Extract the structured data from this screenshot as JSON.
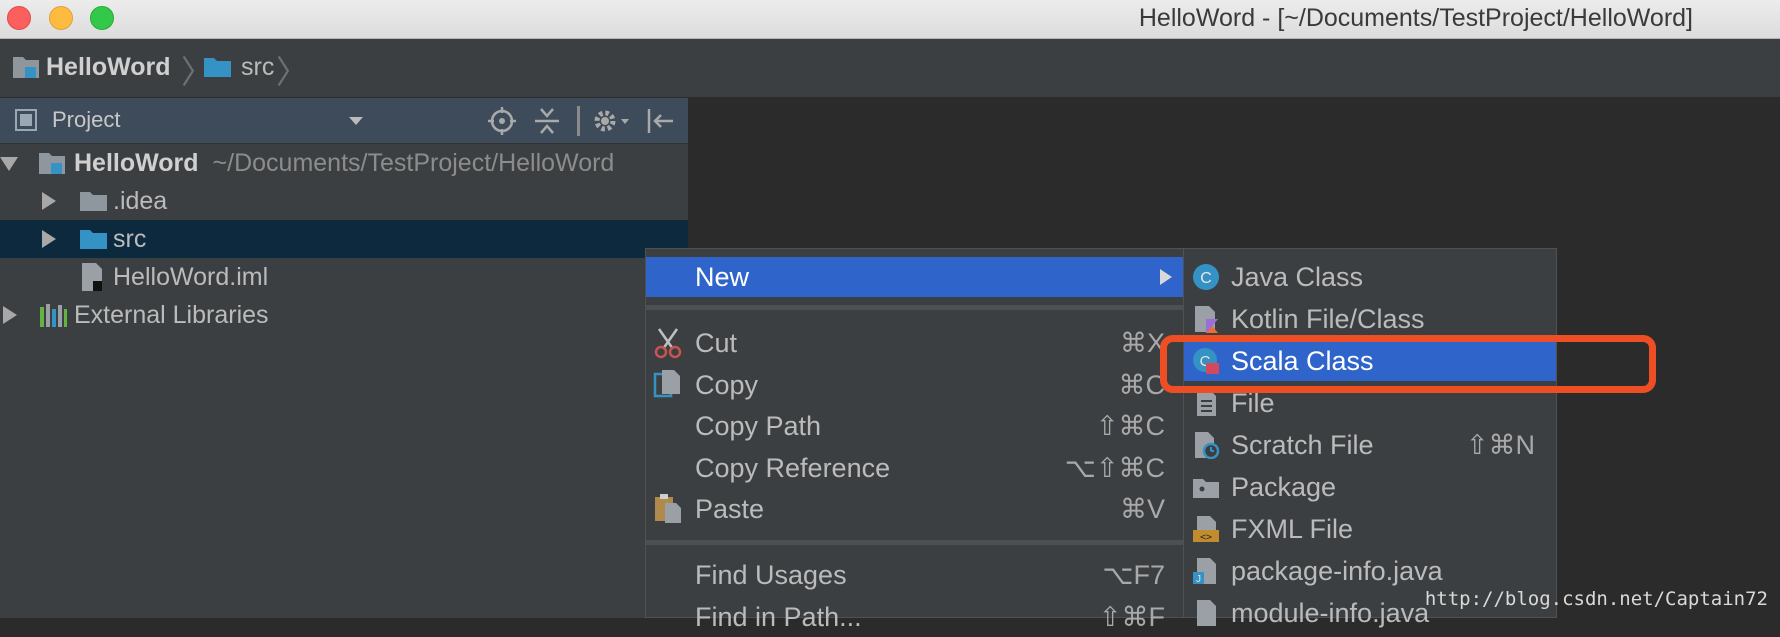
{
  "window": {
    "title": "HelloWord - [~/Documents/TestProject/HelloWord]"
  },
  "breadcrumb": {
    "items": [
      "HelloWord",
      "src"
    ]
  },
  "project_panel": {
    "title": "Project",
    "tree": [
      {
        "label": "HelloWord",
        "path": "~/Documents/TestProject/HelloWord",
        "expanded": true,
        "icon": "module-folder-icon"
      },
      {
        "label": ".idea",
        "icon": "folder-icon"
      },
      {
        "label": "src",
        "icon": "source-folder-icon",
        "selected": true
      },
      {
        "label": "HelloWord.iml",
        "icon": "iml-file-icon"
      },
      {
        "label": "External Libraries",
        "icon": "libraries-icon"
      }
    ]
  },
  "context_menu": {
    "items": [
      {
        "label": "New",
        "shortcut": "",
        "highlighted": true,
        "has_submenu": true
      },
      {
        "label": "Cut",
        "shortcut": "⌘X",
        "icon": "scissors-icon"
      },
      {
        "label": "Copy",
        "shortcut": "⌘C",
        "icon": "copy-icon"
      },
      {
        "label": "Copy Path",
        "shortcut": "⇧⌘C"
      },
      {
        "label": "Copy Reference",
        "shortcut": "⌥⇧⌘C"
      },
      {
        "label": "Paste",
        "shortcut": "⌘V",
        "icon": "paste-icon"
      },
      {
        "label": "Find Usages",
        "shortcut": "⌥F7"
      },
      {
        "label": "Find in Path...",
        "shortcut": "⇧⌘F"
      }
    ]
  },
  "new_submenu": {
    "items": [
      {
        "label": "Java Class",
        "shortcut": "",
        "icon": "java-class-icon"
      },
      {
        "label": "Kotlin File/Class",
        "shortcut": "",
        "icon": "kotlin-file-icon"
      },
      {
        "label": "Scala Class",
        "shortcut": "",
        "icon": "scala-class-icon",
        "highlighted": true
      },
      {
        "label": "File",
        "shortcut": "",
        "icon": "file-icon"
      },
      {
        "label": "Scratch File",
        "shortcut": "⇧⌘N",
        "icon": "scratch-file-icon"
      },
      {
        "label": "Package",
        "shortcut": "",
        "icon": "package-icon"
      },
      {
        "label": "FXML File",
        "shortcut": "",
        "icon": "fxml-file-icon"
      },
      {
        "label": "package-info.java",
        "shortcut": "",
        "icon": "package-info-icon"
      },
      {
        "label": "module-info.java",
        "shortcut": "",
        "icon": "module-info-icon"
      }
    ]
  },
  "watermark": "http://blog.csdn.net/Captain72",
  "colors": {
    "selection": "#2f65ca",
    "annotation_box": "#ee4e23",
    "panel_bg": "#3c3f41",
    "editor_bg": "#2b2b2b"
  }
}
